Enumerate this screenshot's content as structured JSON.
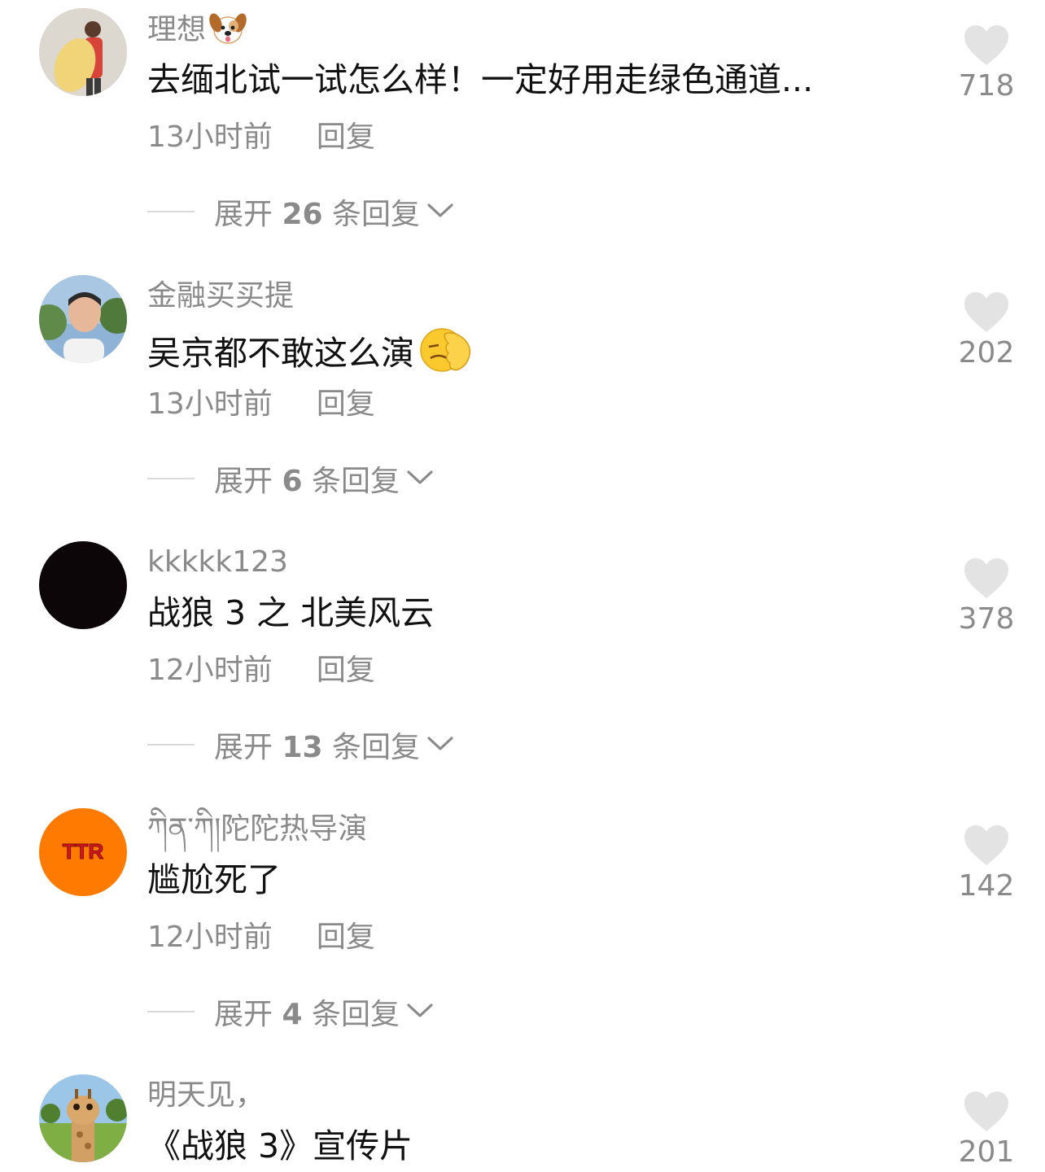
{
  "comments": [
    {
      "username": "理想",
      "username_emoji": "dog-face-emoji",
      "text": "去缅北试一试怎么样！一定好用走绿色通道...",
      "text_emoji": "",
      "time": "13小时前",
      "reply_label": "回复",
      "expand_prefix": "展开",
      "expand_count": "26",
      "expand_suffix": "条回复",
      "likes": "718",
      "avatar": "person-with-surfboard"
    },
    {
      "username": "金融买买提",
      "username_emoji": "",
      "text": "吴京都不敢这么演",
      "text_emoji": "face-palm-emoji",
      "time": "13小时前",
      "reply_label": "回复",
      "expand_prefix": "展开",
      "expand_count": "6",
      "expand_suffix": "条回复",
      "likes": "202",
      "avatar": "man-outdoors"
    },
    {
      "username": "kkkkk123",
      "username_emoji": "",
      "text": "战狼 3 之 北美风云",
      "text_emoji": "",
      "time": "12小时前",
      "reply_label": "回复",
      "expand_prefix": "展开",
      "expand_count": "13",
      "expand_suffix": "条回复",
      "likes": "378",
      "avatar": "black-circle"
    },
    {
      "username": "ཀིན་ཀི།陀陀热导演",
      "username_emoji": "",
      "text": "尴尬死了",
      "text_emoji": "",
      "time": "12小时前",
      "reply_label": "回复",
      "expand_prefix": "展开",
      "expand_count": "4",
      "expand_suffix": "条回复",
      "likes": "142",
      "avatar": "orange-ttr-logo",
      "avatar_text": "TTR"
    },
    {
      "username": "明天见，",
      "username_emoji": "",
      "text": "《战狼 3》宣传片",
      "text_emoji": "",
      "time": "",
      "reply_label": "",
      "expand_prefix": "",
      "expand_count": "",
      "expand_suffix": "",
      "likes": "201",
      "avatar": "giraffe-photo"
    }
  ],
  "colors": {
    "muted": "#8a8a8a",
    "text": "#111111",
    "heart": "#e3e3e3",
    "ttr_orange": "#ff7a00"
  }
}
